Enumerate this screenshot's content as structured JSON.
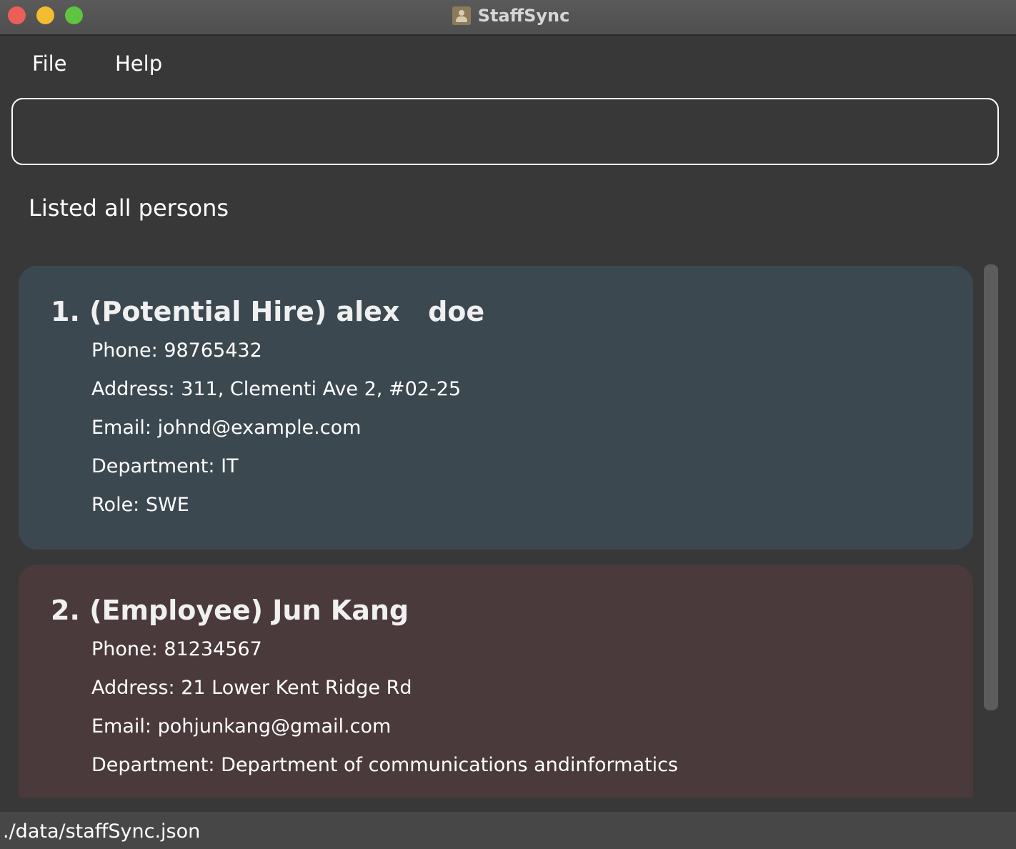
{
  "window": {
    "title": "StaffSync"
  },
  "menu": {
    "file": "File",
    "help": "Help"
  },
  "command_box": {
    "value": "",
    "placeholder": ""
  },
  "result": {
    "message": "Listed all persons"
  },
  "persons": [
    {
      "title": "1. (Potential Hire) alex   doe",
      "phone": "Phone: 98765432",
      "address": "Address: 311, Clementi Ave 2, #02-25",
      "email": "Email: johnd@example.com",
      "department": "Department: IT",
      "role": "Role: SWE"
    },
    {
      "title": "2. (Employee) Jun Kang",
      "phone": "Phone: 81234567",
      "address": "Address: 21 Lower Kent Ridge Rd",
      "email": "Email: pohjunkang@gmail.com",
      "department": "Department: Department of communications andinformatics",
      "role": ""
    }
  ],
  "status_bar": {
    "path": "./data/staffSync.json"
  },
  "colors": {
    "card_potential_hire": "#3c4850",
    "card_employee": "#4a3a3b",
    "background": "#383838"
  }
}
